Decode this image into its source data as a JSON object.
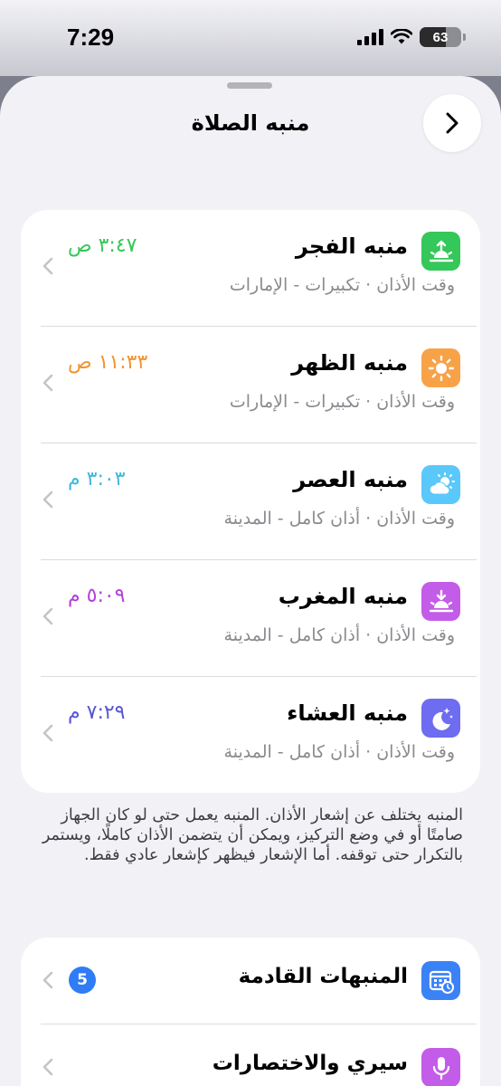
{
  "status_bar": {
    "time": "7:29",
    "battery": "63"
  },
  "header": {
    "title": "منبه الصلاة",
    "back_icon": "chevron-right-icon"
  },
  "prayers": [
    {
      "name": "منبه الفجر",
      "subtitle": "وقت الأذان · تكبيرات - الإمارات",
      "time": "٣:٤٧ ص",
      "time_color": "#34c759",
      "icon": "sunrise-icon",
      "icon_bg": "#34c759"
    },
    {
      "name": "منبه الظهر",
      "subtitle": "وقت الأذان · تكبيرات - الإمارات",
      "time": "١١:٣٣ ص",
      "time_color": "#f2932f",
      "icon": "sun-icon",
      "icon_bg": "#f8a248"
    },
    {
      "name": "منبه العصر",
      "subtitle": "وقت الأذان · أذان كامل - المدينة",
      "time": "٣:٠٣ م",
      "time_color": "#40b7d8",
      "icon": "partly-cloudy-icon",
      "icon_bg": "#5ac8fa"
    },
    {
      "name": "منبه المغرب",
      "subtitle": "وقت الأذان · أذان كامل - المدينة",
      "time": "٥:٠٩ م",
      "time_color": "#b340d8",
      "icon": "sunset-icon",
      "icon_bg": "#c35ce8"
    },
    {
      "name": "منبه العشاء",
      "subtitle": "وقت الأذان · أذان كامل - المدينة",
      "time": "٧:٢٩ م",
      "time_color": "#5856d6",
      "icon": "moon-stars-icon",
      "icon_bg": "#6e6cf0"
    }
  ],
  "footnote": "المنبه يختلف عن إشعار الأذان. المنبه يعمل حتى لو كان الجهاز صامتًا أو في وضع التركيز، ويمكن أن يتضمن الأذان كاملًا، ويستمر بالتكرار حتى توقفه. أما الإشعار فيظهر كإشعار عادي فقط.",
  "menu": [
    {
      "label": "المنبهات القادمة",
      "badge": "5",
      "icon": "calendar-clock-icon",
      "icon_bg": "#3b82f6"
    },
    {
      "label": "سيري والاختصارات",
      "icon": "microphone-icon",
      "icon_bg": "#c35ce8"
    }
  ],
  "colors": {
    "sheet_bg": "#f2f2f6",
    "card_bg": "#ffffff",
    "secondary_text": "#8a8a8f",
    "badge": "#2f7cf6"
  }
}
